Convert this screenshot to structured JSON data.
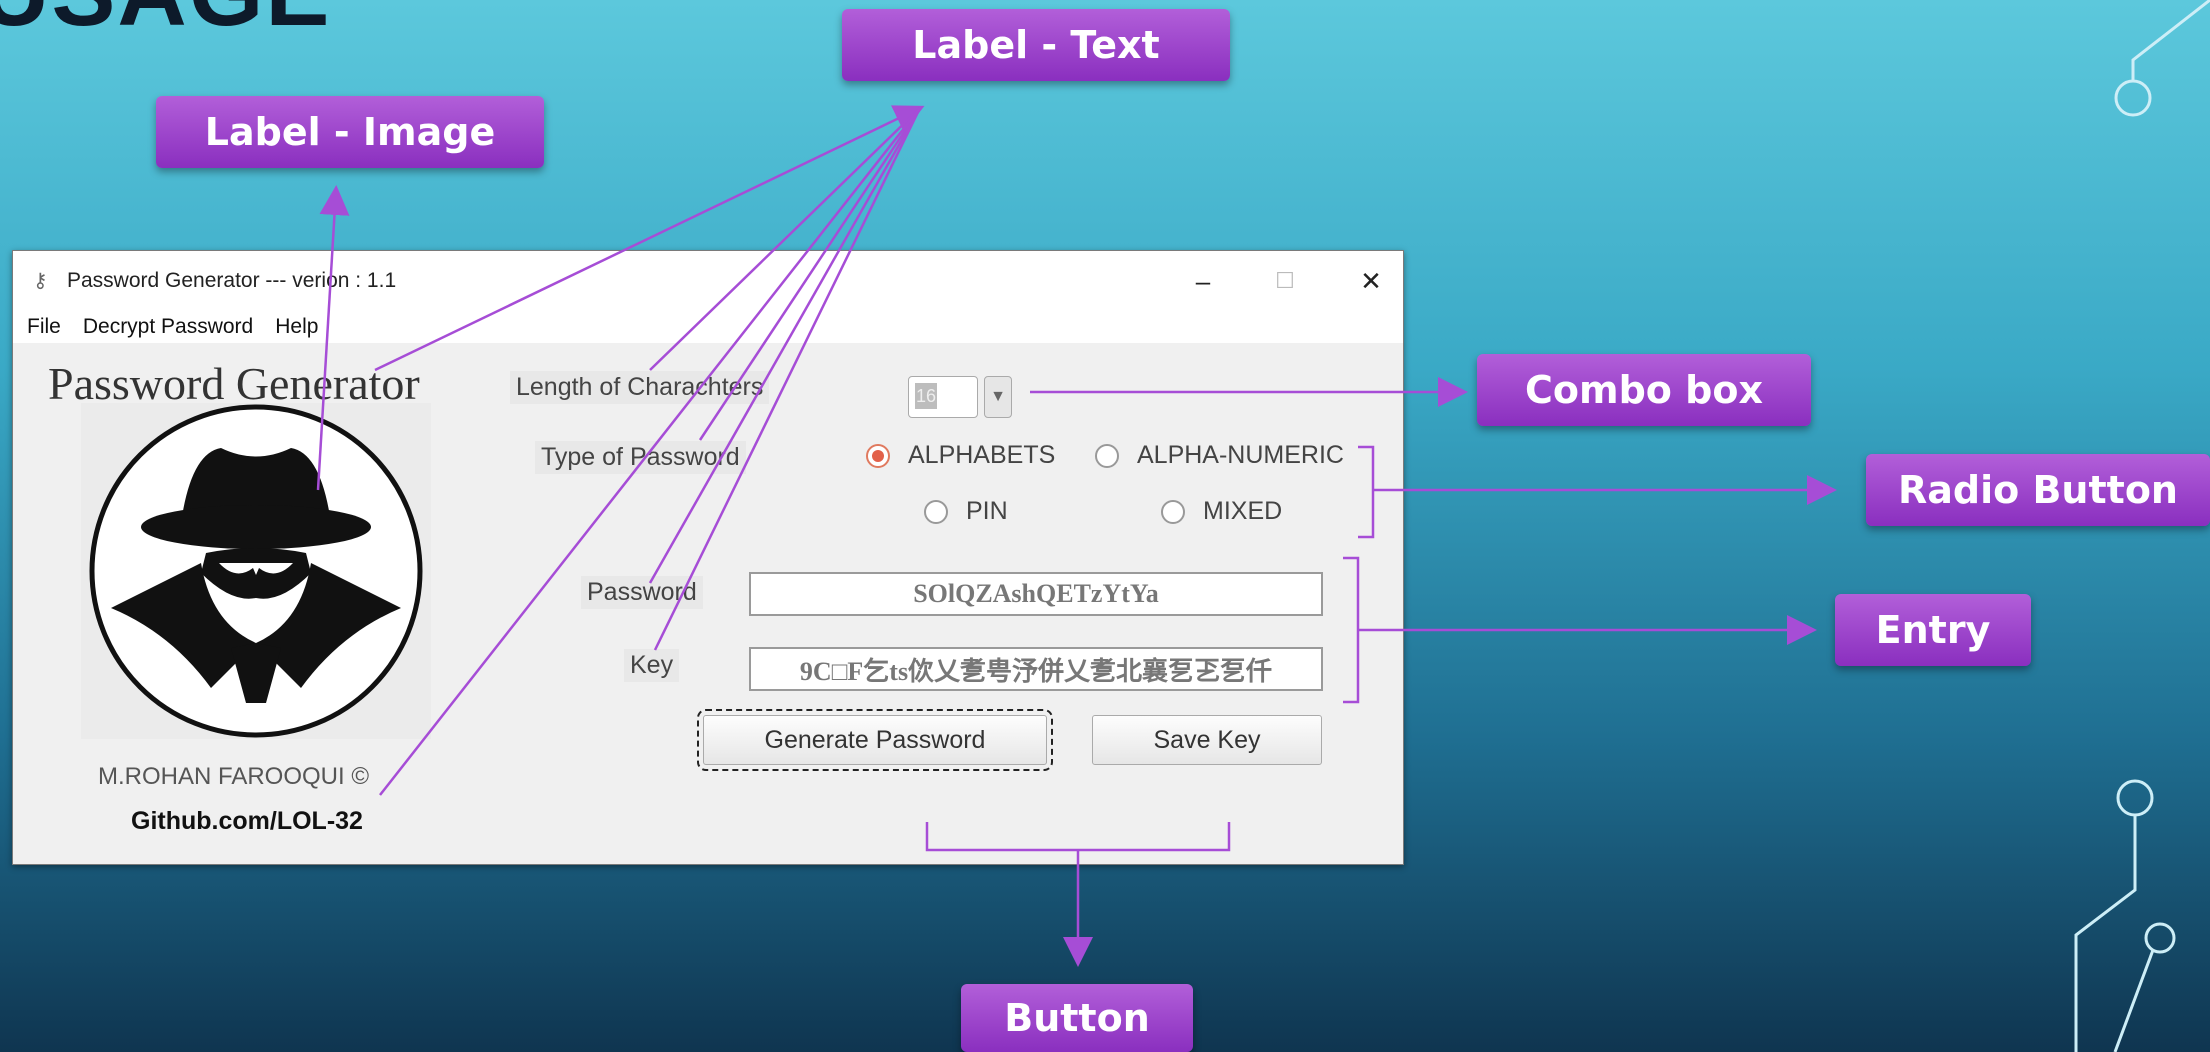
{
  "slide": {
    "title": "USAGE"
  },
  "callouts": {
    "label_text": "Label - Text",
    "label_image": "Label - Image",
    "combo_box": "Combo box",
    "radio_button": "Radio Button",
    "entry": "Entry",
    "button": "Button"
  },
  "window": {
    "title": "Password Generator --- verion : 1.1",
    "minimize": "–",
    "maximize": "☐",
    "close": "✕"
  },
  "menu": [
    "File",
    "Decrypt Password",
    "Help"
  ],
  "left_panel": {
    "title": "Password Generator",
    "image_icon": "spy-hat-icon",
    "author": "M.ROHAN FAROOQUI ©",
    "github": "Github.com/LOL-32"
  },
  "form": {
    "length_label": "Length of  Charachters",
    "length_value": "16",
    "type_label": "Type of  Password",
    "radios": [
      {
        "label": "ALPHABETS",
        "selected": true
      },
      {
        "label": "ALPHA-NUMERIC",
        "selected": false
      },
      {
        "label": "PIN",
        "selected": false
      },
      {
        "label": "MIXED",
        "selected": false
      }
    ],
    "password_label": "Password",
    "password_value": "SOlQZAshQETzYtYa",
    "key_label": "Key",
    "key_value": "9C□F乞ts佽乂乽甹汿併乂乽北襄乭乤乭仟",
    "generate_button": "Generate Password",
    "save_button": "Save Key"
  },
  "colors": {
    "callout": "#9b3fcc",
    "arrow": "#a64dd6",
    "radio_on": "#e2614a"
  }
}
